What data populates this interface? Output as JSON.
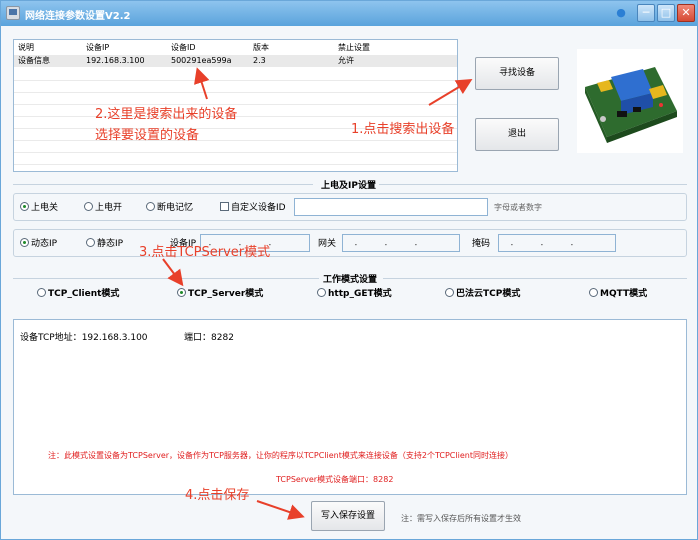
{
  "window": {
    "title": "网络连接参数设置V2.2",
    "pin_glyph": "●",
    "minimize_glyph": "─",
    "maximize_glyph": "□",
    "close_glyph": "✕"
  },
  "device_list": {
    "columns": [
      "说明",
      "设备IP",
      "设备ID",
      "版本",
      "禁止设置"
    ],
    "rows": [
      [
        "设备信息",
        "192.168.3.100",
        "500291ea599a",
        "2.3",
        "允许"
      ]
    ]
  },
  "buttons": {
    "search": "寻找设备",
    "exit": "退出",
    "save": "写入保存设置"
  },
  "power_ip_section": {
    "label": "上电及IP设置",
    "power_options": [
      {
        "label": "上电关",
        "selected": true
      },
      {
        "label": "上电开",
        "selected": false
      },
      {
        "label": "断电记忆",
        "selected": false
      }
    ],
    "custom_id": {
      "label": "自定义设备ID",
      "checked": false,
      "value": ""
    },
    "custom_id_hint": "字母或者数字",
    "ip_mode_options": [
      {
        "label": "动态IP",
        "selected": true
      },
      {
        "label": "静态IP",
        "selected": false
      }
    ],
    "device_ip_label": "设备IP",
    "gateway_label": "网关",
    "mask_label": "掩码",
    "ip_placeholder": "．．．"
  },
  "work_mode_section": {
    "label": "工作模式设置",
    "modes": [
      {
        "label": "TCP_Client模式",
        "selected": false
      },
      {
        "label": "TCP_Server模式",
        "selected": true
      },
      {
        "label": "http_GET模式",
        "selected": false
      },
      {
        "label": "巴法云TCP模式",
        "selected": false
      },
      {
        "label": "MQTT模式",
        "selected": false
      }
    ]
  },
  "info": {
    "device_tcp_address_label": "设备TCP地址：",
    "device_tcp_address": "192.168.3.100",
    "port_label": "端口：",
    "port": "8282",
    "note": "注：此模式设置设备为TCPServer，设备作为TCP服务器，让你的程序以TCPClient模式来连接设备（支持2个TCPClient同时连接）",
    "server_port_line": "TCPServer模式设备端口：8282"
  },
  "save_note": "注：需写入保存后所有设置才生效",
  "annotations": {
    "step1": "1.点击搜索出设备",
    "step2_line1": "2.这里是搜索出来的设备",
    "step2_line2": "选择要设置的设备",
    "step3": "3.点击TCPServer模式",
    "step4": "4.点击保存"
  },
  "colors": {
    "annotation": "#e8402a",
    "titlebar": "#5aa3dc",
    "note": "#e02020"
  }
}
